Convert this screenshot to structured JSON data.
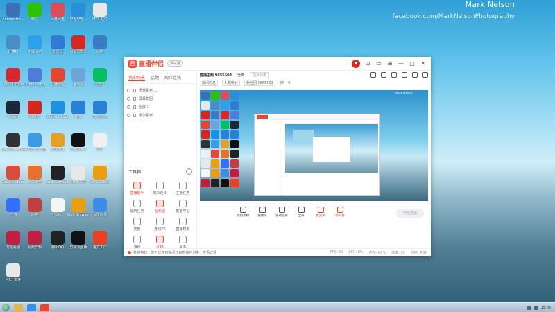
{
  "watermark": {
    "name": "Mark Nelson",
    "url": "facebook.com/MarkNelsonPhotography"
  },
  "desktop_icons": [
    {
      "label": "Administra...",
      "color": "#3b6fb6"
    },
    {
      "label": "微信",
      "color": "#2dc100"
    },
    {
      "label": "百度网盘",
      "color": "#e04b5a"
    },
    {
      "label": "哔哩哔哩...",
      "color": "#2a8fd6"
    },
    {
      "label": "MP3 文件",
      "color": "#e8e8e8"
    },
    {
      "label": "计算机",
      "color": "#4a8cc8"
    },
    {
      "label": "无线网络",
      "color": "#2aa1e8"
    },
    {
      "label": "浏览器",
      "color": "#2f7bd6"
    },
    {
      "label": "网易云音乐",
      "color": "#d5261f"
    },
    {
      "label": "网络",
      "color": "#3a7cc4"
    },
    {
      "label": "WPS Office",
      "color": "#d8272c"
    },
    {
      "label": "Chrome Browser",
      "color": "#4d7dd6"
    },
    {
      "label": "直播伴侣",
      "color": "#e8452f"
    },
    {
      "label": "回收站",
      "color": "#6aa6d8"
    },
    {
      "label": "爱奇艺",
      "color": "#00c060"
    },
    {
      "label": "Steam",
      "color": "#1b2838"
    },
    {
      "label": "网易云",
      "color": "#d5261f"
    },
    {
      "label": "Internet Explorer",
      "color": "#1e90e0"
    },
    {
      "label": "酷狗",
      "color": "#2a7fd6"
    },
    {
      "label": "软件管家",
      "color": "#2a7fd6"
    },
    {
      "label": "EasyScreenR...",
      "color": "#333333"
    },
    {
      "label": "360安全浏览器",
      "color": "#3a9be8"
    },
    {
      "label": "游戏加速",
      "color": "#e8a020"
    },
    {
      "label": "WeGame",
      "color": "#111111"
    },
    {
      "label": "文件",
      "color": "#f0f0f0"
    },
    {
      "label": "Google Chrome",
      "color": "#dd4b3e"
    },
    {
      "label": "火绒安全",
      "color": "#e8702a"
    },
    {
      "label": "Epic Games Launcher",
      "color": "#222222"
    },
    {
      "label": "MP3 文件",
      "color": "#e8e8e8"
    },
    {
      "label": "WPS Office",
      "color": "#e8a010"
    },
    {
      "label": "飞书",
      "color": "#3370ff"
    },
    {
      "label": "原神",
      "color": "#c04040"
    },
    {
      "label": "视频",
      "color": "#f5f5f5"
    },
    {
      "label": "Web Browser",
      "color": "#e8a010"
    },
    {
      "label": "百度网盘",
      "color": "#3a8ee8"
    },
    {
      "label": "万能看图",
      "color": "#c02040"
    },
    {
      "label": "视频剪辑",
      "color": "#c02040"
    },
    {
      "label": "腾讯QQ",
      "color": "#222222"
    },
    {
      "label": "剪映专业版",
      "color": "#111111"
    },
    {
      "label": "格式工厂",
      "color": "#e84020"
    },
    {
      "label": "MP3 文件",
      "color": "#e8e8e8"
    }
  ],
  "app": {
    "brand": "直播伴侣",
    "logo_glyph": "直",
    "version_badge": "测试版",
    "window_controls": [
      "⊡",
      "▭",
      "⊞",
      "—",
      "□",
      "✕"
    ],
    "tabs": [
      "我的场景",
      "话题",
      "观众连线"
    ],
    "scenes": [
      {
        "label": "场景素材 11"
      },
      {
        "label": "屏幕截图"
      },
      {
        "label": "全屏 1"
      },
      {
        "label": "添加素材"
      }
    ],
    "tools_title": "工具箱",
    "tools_settings_glyph": "···",
    "tools": [
      {
        "label": "直播助手",
        "hot": true
      },
      {
        "label": "观众连线",
        "hot": false
      },
      {
        "label": "主播任务",
        "hot": false
      },
      {
        "label": "福利任务",
        "hot": false
      },
      {
        "label": "福利送",
        "hot": true
      },
      {
        "label": "数据中心",
        "hot": false
      },
      {
        "label": "美颜",
        "hot": false
      },
      {
        "label": "连线PK",
        "hot": false
      },
      {
        "label": "直播权限",
        "hot": false
      },
      {
        "label": "游戏",
        "hot": false
      },
      {
        "label": "礼物",
        "hot": true
      },
      {
        "label": "更多",
        "hot": false
      }
    ],
    "notice": "礼物特效，你可以在直播间开启直播伴侣中，查看详情",
    "status": [
      "FPS: 30",
      "CPU: 8%",
      "内存: 60%",
      "帧率: 30",
      "网络: 良好"
    ],
    "room": {
      "title": "直播主题 9855503",
      "category_label": "分类",
      "category_placeholder": "选择分类",
      "info": [
        "房间信息",
        "人数统计",
        "粉丝团 9855503",
        "87",
        "0"
      ]
    },
    "preview_caption": "Mark Nelson",
    "bottom_tools": [
      {
        "label": "添加素材",
        "red": false
      },
      {
        "label": "摄像头",
        "red": false
      },
      {
        "label": "游戏投屏",
        "red": false
      },
      {
        "label": "全屏",
        "red": false
      },
      {
        "label": "麦克风",
        "red": true
      },
      {
        "label": "扬声器",
        "red": true
      }
    ],
    "start_live": "开始直播"
  },
  "taskbar": {
    "time": "15:03",
    "pinned": [
      {
        "name": "explorer",
        "color": "#e2b64a"
      },
      {
        "name": "browser",
        "color": "#3a8ee8"
      },
      {
        "name": "live-companion",
        "color": "#e8452f"
      }
    ]
  }
}
